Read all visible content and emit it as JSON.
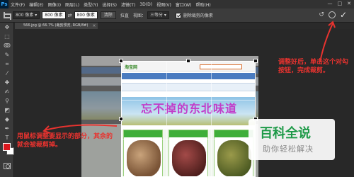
{
  "app": {
    "logo": "Ps"
  },
  "menubar": {
    "items": [
      "文件(F)",
      "编辑(E)",
      "图像(I)",
      "图层(L)",
      "类型(Y)",
      "选择(S)",
      "滤镜(T)",
      "3D(D)",
      "视图(V)",
      "窗口(W)",
      "帮助(H)"
    ],
    "window_controls": [
      "—",
      "□",
      "✕"
    ]
  },
  "options_bar": {
    "ratio_select": "800 像素 ▾",
    "width_value": "800 像素",
    "height_value": "800 像素",
    "swap_label": "⇄",
    "clear_button": "清除",
    "straighten_label": "拉直",
    "view_label": "视图：",
    "view_select": "三等分 ▾",
    "delete_cropped_label": "删除裁剪的像素"
  },
  "document": {
    "tab_label": "566.jpg @ 66.7% (裁剪预览, RGB/8#)",
    "tab_close": "×"
  },
  "canvas": {
    "site_logo": "淘宝网",
    "banner_text": "忘不掉的东北味道"
  },
  "annotations": {
    "left": "用鼠标调整要显示的部分，其余的就会被裁剪掉。",
    "right": "调整好后，单击这个对勾按钮，完成裁剪。"
  },
  "watermark": {
    "title": "百科全说",
    "subtitle": "助你轻松解决"
  },
  "colors": {
    "foreground": "#d9161c",
    "background": "#ffffff",
    "annotation": "#e8332f",
    "watermark_green": "#1e9a48"
  },
  "tools": [
    "move-tool",
    "marquee-tool",
    "lasso-tool",
    "quick-select-tool",
    "crop-tool",
    "eyedropper-tool",
    "healing-tool",
    "brush-tool",
    "stamp-tool",
    "history-brush-tool",
    "eraser-tool",
    "gradient-tool",
    "blur-tool",
    "dodge-tool",
    "pen-tool",
    "type-tool",
    "path-select-tool",
    "shape-tool",
    "hand-tool",
    "zoom-tool"
  ]
}
